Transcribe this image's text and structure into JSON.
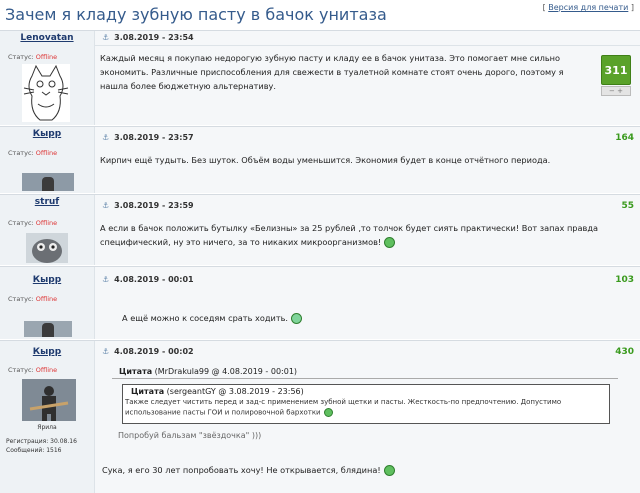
{
  "page": {
    "title": "Зачем я кладу зубную пасту в бачок унитаза",
    "print_prefix": "[ ",
    "print_link": "Версия для печати",
    "print_suffix": " ]"
  },
  "status_label": "Статус:",
  "status_value": "Offline",
  "posts": [
    {
      "user": "Lenovatan",
      "date": "3.08.2019 - 23:54",
      "text": "Каждый месяц я покупаю недорогую зубную пасту и кладу ее в бачок унитаза. Это помогает мне сильно экономить. Различные приспособления для свежести в туалетной комнате стоят очень дорого, поэтому я нашла более бюджетную альтернативу.",
      "score": "311",
      "vote_minus": "−",
      "vote_plus": "+"
    },
    {
      "user": "Кырр",
      "date": "3.08.2019 - 23:57",
      "text": "Кирпич ещё тудыть. Без шуток. Объём воды уменьшится. Экономия будет в конце отчётного периода.",
      "score": "164"
    },
    {
      "user": "struf",
      "date": "3.08.2019 - 23:59",
      "text": "А если в бачок положить бутылку «Белизны» за 25 рублей ,то толчок будет сиять практически! Вот запах правда специфический, ну это ничего, за то никаких микроорганизмов!",
      "score": "55"
    },
    {
      "user": "Кырр",
      "date": "4.08.2019 - 00:01",
      "text": "А ещё можно к соседям срать ходить.",
      "score": "103"
    },
    {
      "user": "Кырр",
      "date": "4.08.2019 - 00:02",
      "score": "430",
      "avatar_caption": "Ярила",
      "reg_label": "Регистрация: 30.08.16",
      "posts_label": "Сообщений: 1516",
      "quote_outer_label": "Цитата",
      "quote_outer_meta": "(MrDrakula99 @ 4.08.2019 - 00:01)",
      "quote_inner_label": "Цитата",
      "quote_inner_meta": "(sergeantGY @ 3.08.2019 - 23:56)",
      "quote_inner_text": "Также следует чистить перед и зад-с применением зубной щетки и пасты. Жесткость-по предпочтению. Допустимо использование пасты ГОИ и полировочной бархотки",
      "quote_outer_text": "Попробуй бальзам \"звёздочка\" )))",
      "text": "Сука, я его 30 лет попробовать хочу! Не открывается, блядина!"
    }
  ]
}
